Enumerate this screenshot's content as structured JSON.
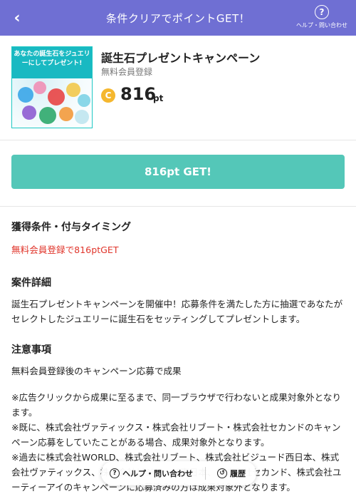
{
  "header": {
    "title": "条件クリアでポイントGET！",
    "back_icon": "chevron-left-icon",
    "help_label": "ヘルプ・問い合わせ",
    "help_icon": "question-circle-icon"
  },
  "campaign": {
    "thumbnail_text": "あなたの誕生石をジュエリーにしてプレゼント!",
    "name": "誕生石プレゼントキャンペーン",
    "category": "無料会員登録",
    "coin_symbol": "C",
    "points": "816",
    "points_unit": "pt"
  },
  "get_button": {
    "label": "816pt GET!"
  },
  "sections": {
    "condition": {
      "title": "獲得条件・付与タイミング",
      "text": "無料会員登録で816ptGET"
    },
    "detail": {
      "title": "案件詳細",
      "text": "誕生石プレゼントキャンペーンを開催中！応募条件を満たした方に抽選であなたがセレクトしたジュエリーに誕生石をセッティングしてプレゼントします。"
    },
    "notes": {
      "title": "注意事項",
      "line1": "無料会員登録後のキャンペーン応募で成果",
      "line2": "※広告クリックから成果に至るまで、同一ブラウザで行わないと成果対象外となります。",
      "line3": "※既に、株式会社ヴァティックス・株式会社リブート・株式会社セカンドのキャンペーン応募をしていたことがある場合、成果対象外となります。",
      "line4": "※過去に株式会社WORLD、株式会社リブート、株式会社ビジュード西日本、株式会社ヴァティックス、株式会社ビジュード東日本、株式会社セカンド、株式会社ユーティーアイのキャンペーンに応募済みの方は成果対象外となります。"
    }
  },
  "footer": {
    "help_label": "ヘルプ・問い合わせ",
    "history_label": "履歴",
    "help_icon": "question-circle-icon",
    "history_icon": "clock-history-icon"
  },
  "colors": {
    "header_bg": "#6f6fd3",
    "get_button_bg": "#54c7b8",
    "condition_red": "#e0352b",
    "coin": "#f5b72e"
  }
}
